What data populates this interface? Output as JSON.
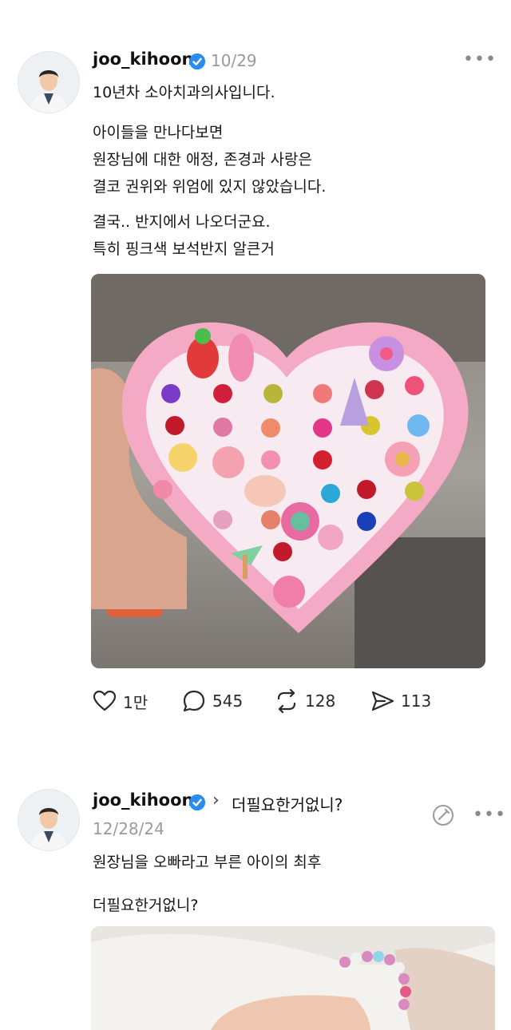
{
  "post1": {
    "username": "joo_kihoon",
    "date": "10/29",
    "lines": [
      "10년차 소아치과의사입니다.",
      "아이들을 만나다보면",
      "원장님에 대한 애정, 존경과 사랑은",
      "결코 권위와 위엄에 있지 않았습니다.",
      "결국.. 반지에서 나오더군요.",
      "특히 핑크색 보석반지 알큰거"
    ],
    "actions": {
      "likes": "1만",
      "comments": "545",
      "reposts": "128",
      "shares": "113"
    }
  },
  "post2": {
    "username": "joo_kihoon",
    "reply_to": "더필요한거없니?",
    "date": "12/28/24",
    "lines": [
      "원장님을 오빠라고 부른 아이의 최후",
      "더필요한거없니?"
    ]
  },
  "colors": {
    "verified": "#2a8cf0",
    "heart_box": "#f4a9c4",
    "muted": "#9a9a9a"
  }
}
